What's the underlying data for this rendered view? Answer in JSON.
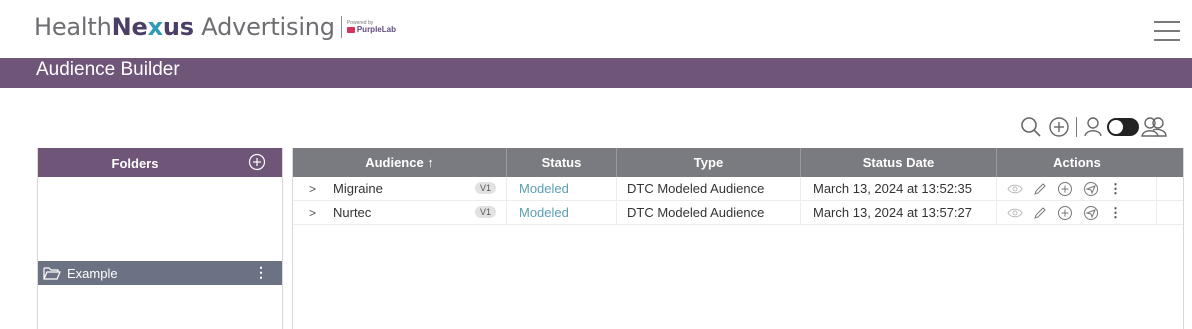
{
  "header": {
    "brand_prefix": "Health",
    "brand_bold_a": "Ne",
    "brand_x": "x",
    "brand_bold_b": "us",
    "brand_suffix": " Advertising",
    "powered_by": "Powered by",
    "powered_logo": "PurpleLab"
  },
  "titlebar": {
    "title": "Audience Builder"
  },
  "toolbar": {
    "icons": [
      "search-icon",
      "add-circle-icon",
      "user-icon",
      "toggle-switch",
      "users-icon"
    ]
  },
  "folders": {
    "title": "Folders",
    "items": [
      {
        "label": "Example",
        "icon": "folder-open-icon"
      }
    ]
  },
  "table": {
    "columns": {
      "audience": "Audience ↑",
      "status": "Status",
      "type": "Type",
      "status_date": "Status Date",
      "actions": "Actions"
    },
    "rows": [
      {
        "expand": ">",
        "name": "Migraine",
        "version": "V1",
        "status": "Modeled",
        "type": "DTC Modeled Audience",
        "status_date": "March 13, 2024 at 13:52:35"
      },
      {
        "expand": ">",
        "name": "Nurtec",
        "version": "V1",
        "status": "Modeled",
        "type": "DTC Modeled Audience",
        "status_date": "March 13, 2024 at 13:57:27"
      }
    ],
    "action_icons": [
      "eye-icon",
      "pencil-icon",
      "add-circle-icon",
      "send-icon",
      "more-vertical-icon"
    ]
  },
  "colors": {
    "accent_purple": "#6f5578",
    "header_gray": "#7a7b80",
    "folder_selected": "#6a7284",
    "status_link": "#5a9fb3"
  }
}
